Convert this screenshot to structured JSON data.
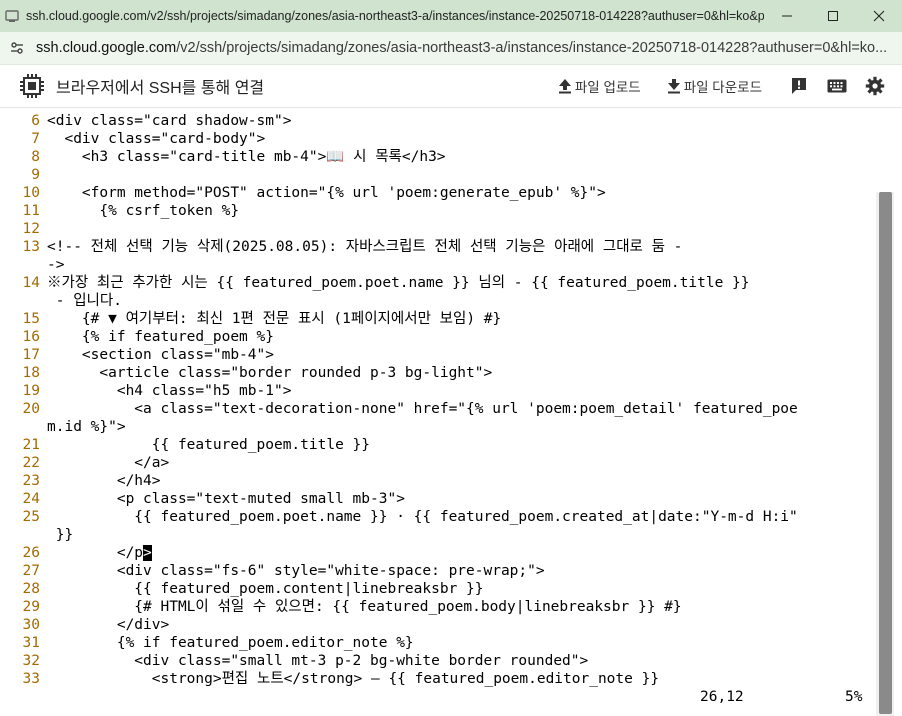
{
  "window": {
    "title": "ssh.cloud.google.com/v2/ssh/projects/simadang/zones/asia-northeast3-a/instances/instance-20250718-014228?authuser=0&hl=ko&p..."
  },
  "address": {
    "host": "ssh.cloud.google.com",
    "path": "/v2/ssh/projects/simadang/zones/asia-northeast3-a/instances/instance-20250718-014228?authuser=0&hl=ko..."
  },
  "toolbar": {
    "title": "브라우저에서 SSH를 통해 연결",
    "upload_label": "파일 업로드",
    "download_label": "파일 다운로드"
  },
  "editor": {
    "lines": [
      {
        "n": "6",
        "text": "<div class=\"card shadow-sm\">"
      },
      {
        "n": "7",
        "text": "  <div class=\"card-body\">"
      },
      {
        "n": "8",
        "text": "    <h3 class=\"card-title mb-4\">📖 시 목록</h3>"
      },
      {
        "n": "9",
        "text": ""
      },
      {
        "n": "10",
        "text": "    <form method=\"POST\" action=\"{% url 'poem:generate_epub' %}\">"
      },
      {
        "n": "11",
        "text": "      {% csrf_token %}"
      },
      {
        "n": "12",
        "text": ""
      },
      {
        "n": "13",
        "text": "<!-- 전체 선택 기능 삭제(2025.08.05): 자바스크립트 전체 선택 기능은 아래에 그대로 둠 -",
        "cont": "->"
      },
      {
        "n": "14",
        "text": "※가장 최근 추가한 시는 {{ featured_poem.poet.name }} 님의 - {{ featured_poem.title }}",
        "cont": " - 입니다."
      },
      {
        "n": "15",
        "text": "    {# ▼ 여기부터: 최신 1편 전문 표시 (1페이지에서만 보임) #}"
      },
      {
        "n": "16",
        "text": "    {% if featured_poem %}"
      },
      {
        "n": "17",
        "text": "    <section class=\"mb-4\">"
      },
      {
        "n": "18",
        "text": "      <article class=\"border rounded p-3 bg-light\">"
      },
      {
        "n": "19",
        "text": "        <h4 class=\"h5 mb-1\">"
      },
      {
        "n": "20",
        "text": "          <a class=\"text-decoration-none\" href=\"{% url 'poem:poem_detail' featured_poe",
        "cont": "m.id %}\">"
      },
      {
        "n": "21",
        "text": "            {{ featured_poem.title }}"
      },
      {
        "n": "22",
        "text": "          </a>"
      },
      {
        "n": "23",
        "text": "        </h4>"
      },
      {
        "n": "24",
        "text": "        <p class=\"text-muted small mb-3\">"
      },
      {
        "n": "25",
        "text": "          {{ featured_poem.poet.name }} · {{ featured_poem.created_at|date:\"Y-m-d H:i\"",
        "cont": " }}"
      },
      {
        "n": "26",
        "text": "        </p",
        "cursor_char": ">"
      },
      {
        "n": "27",
        "text": "        <div class=\"fs-6\" style=\"white-space: pre-wrap;\">"
      },
      {
        "n": "28",
        "text": "          {{ featured_poem.content|linebreaksbr }}"
      },
      {
        "n": "29",
        "text": "          {# HTML이 섞일 수 있으면: {{ featured_poem.body|linebreaksbr }} #}"
      },
      {
        "n": "30",
        "text": "        </div>"
      },
      {
        "n": "31",
        "text": "        {% if featured_poem.editor_note %}"
      },
      {
        "n": "32",
        "text": "          <div class=\"small mt-3 p-2 bg-white border rounded\">"
      },
      {
        "n": "33",
        "text": "            <strong>편집 노트</strong> — {{ featured_poem.editor_note }}"
      }
    ],
    "status_position": "26,12",
    "status_percent": "5%"
  }
}
